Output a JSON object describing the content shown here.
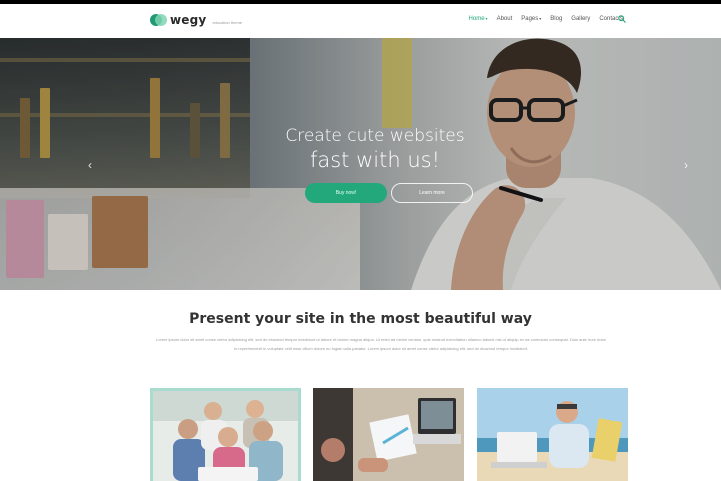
{
  "header": {
    "logo": {
      "name": "wegy",
      "tagline": "education theme"
    },
    "nav": [
      {
        "label": "Home",
        "active": true,
        "dropdown": true
      },
      {
        "label": "About",
        "active": false,
        "dropdown": false
      },
      {
        "label": "Pages",
        "active": false,
        "dropdown": true
      },
      {
        "label": "Blog",
        "active": false,
        "dropdown": false
      },
      {
        "label": "Gallery",
        "active": false,
        "dropdown": false
      },
      {
        "label": "Contacts",
        "active": false,
        "dropdown": false
      }
    ],
    "search_icon": "search-icon"
  },
  "hero": {
    "title_line1": "Create cute websites",
    "title_line2": "fast with us!",
    "primary_button": "Buy now!",
    "secondary_button": "Learn more",
    "prev_icon": "chevron-left-icon",
    "next_icon": "chevron-right-icon"
  },
  "section": {
    "title": "Present your site in the most beautiful way",
    "text": "Lorem ipsum dolor sit amet conse ctetur adipisicing elit, sed do eiusmod tempor incididunt ut labore et dolore magna aliqua. Ut enim ad minim veniam, quis nostrud exercitation ullamco laboris nisi ut aliquip ex ea commodo consequat. Duis aute irure dolor in reprehenderit in voluptate velit esse cillum dolore eu fugiat nulla pariatur. Lorem ipsum dolor sit amet conse ctetur adipisicing elit, sed do eiusmod tempor incididunt."
  },
  "cards": [
    {
      "image": "group-of-students-photo"
    },
    {
      "image": "team-working-with-laptop-photo"
    },
    {
      "image": "man-with-laptop-on-beach-photo"
    }
  ],
  "colors": {
    "accent": "#22a87b",
    "card_border": "#a9dccf",
    "background": "#ffffff"
  }
}
